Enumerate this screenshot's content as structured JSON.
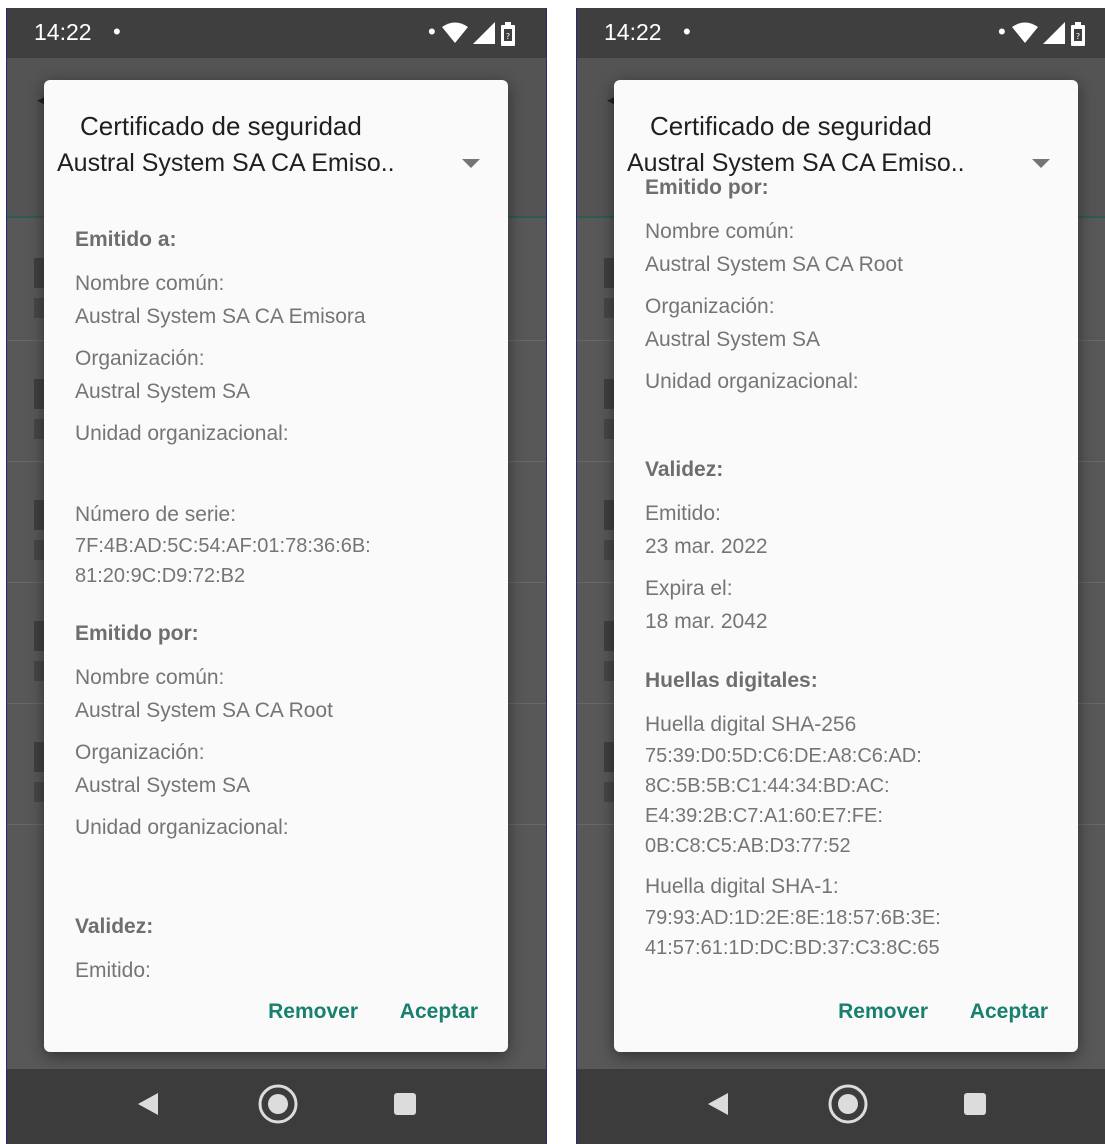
{
  "status": {
    "time": "14:22",
    "dot": "•"
  },
  "dialog": {
    "title": "Certificado de seguridad",
    "selected_cert": "Austral System SA CA Emiso..",
    "remove_label": "Remover",
    "accept_label": "Aceptar"
  },
  "issued_to": {
    "header": "Emitido a:",
    "common_name_label": "Nombre común:",
    "common_name": "Austral System SA CA Emisora",
    "org_label": "Organización:",
    "org": "Austral System SA",
    "ou_label": "Unidad organizacional:",
    "serial_label": "Número de serie:",
    "serial_line1": "7F:4B:AD:5C:54:AF:01:78:36:6B:",
    "serial_line2": "81:20:9C:D9:72:B2"
  },
  "issued_by": {
    "header": "Emitido por:",
    "common_name_label": "Nombre común:",
    "common_name": "Austral System SA CA Root",
    "org_label": "Organización:",
    "org": "Austral System SA",
    "ou_label": "Unidad organizacional:"
  },
  "validity": {
    "header": "Validez:",
    "issued_label": "Emitido:",
    "issued": "23 mar. 2022",
    "expires_label": "Expira el:",
    "expires": "18 mar. 2042"
  },
  "fingerprints": {
    "header": "Huellas digitales:",
    "sha256_label": "Huella digital SHA-256",
    "sha256_lines": [
      "75:39:D0:5D:C6:DE:A8:C6:AD:",
      "8C:5B:5B:C1:44:34:BD:AC:",
      "E4:39:2B:C7:A1:60:E7:FE:",
      "0B:C8:C5:AB:D3:77:52"
    ],
    "sha1_label": "Huella digital SHA-1:",
    "sha1_lines": [
      "79:93:AD:1D:2E:8E:18:57:6B:3E:",
      "41:57:61:1D:DC:BD:37:C3:8C:65"
    ]
  },
  "icons": {
    "wifi": "wifi-icon",
    "signal": "signal-icon",
    "battery": "battery-icon",
    "back": "back-arrow-icon",
    "dropdown": "caret-down-icon",
    "nav_back": "nav-back-icon",
    "nav_home": "nav-home-icon",
    "nav_recents": "nav-recents-icon"
  },
  "colors": {
    "accent": "#17806f",
    "scrim": "#585858",
    "dialog_bg": "#fafafa"
  }
}
